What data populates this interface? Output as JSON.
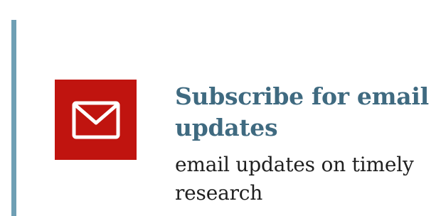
{
  "subscribe": {
    "title": "Subscribe for email updates",
    "description": "email updates on timely research",
    "icon": "envelope-icon"
  },
  "colors": {
    "accent_bar": "#6f9fb4",
    "icon_background": "#c0140f",
    "title": "#3f6a80",
    "description": "#1f1f1f"
  }
}
